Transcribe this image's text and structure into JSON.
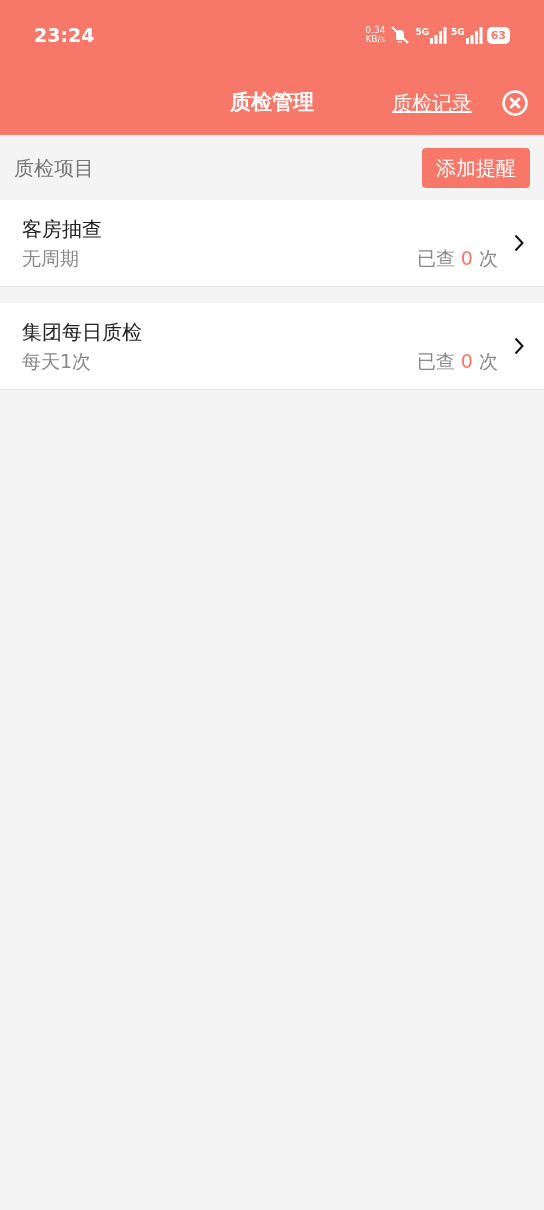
{
  "status_bar": {
    "time": "23:24",
    "speed_value": "0.34",
    "speed_unit": "KB/s",
    "sim1": "5G",
    "sim2": "5G",
    "battery": "63"
  },
  "header": {
    "title": "质检管理",
    "action": "质检记录"
  },
  "section": {
    "label": "质检项目",
    "button": "添加提醒"
  },
  "items": [
    {
      "title": "客房抽查",
      "cycle": "无周期",
      "count_prefix": "已查",
      "count": "0",
      "count_suffix": "次"
    },
    {
      "title": "集团每日质检",
      "cycle": "每天1次",
      "count_prefix": "已查",
      "count": "0",
      "count_suffix": "次"
    }
  ]
}
